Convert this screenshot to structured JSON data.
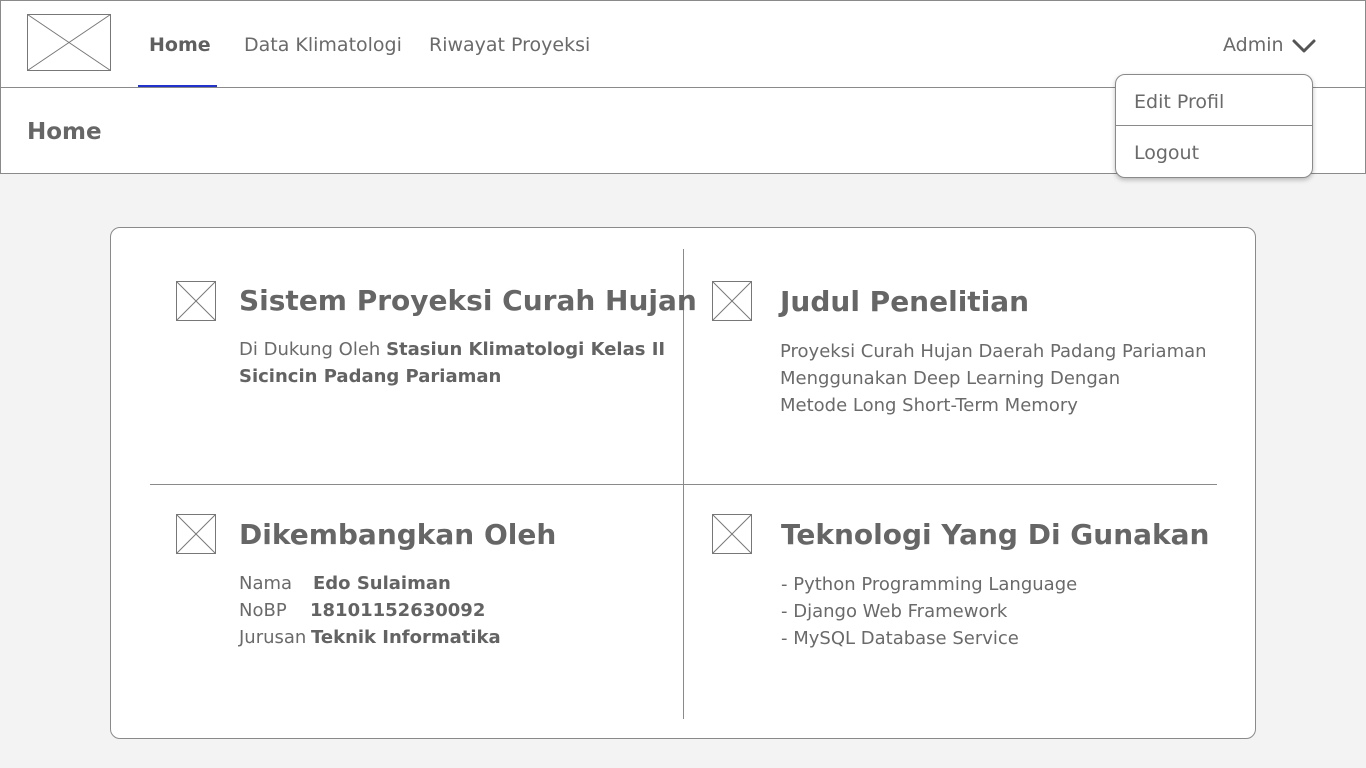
{
  "nav": {
    "items": [
      {
        "label": "Home",
        "active": true
      },
      {
        "label": "Data Klimatologi",
        "active": false
      },
      {
        "label": "Riwayat Proyeksi",
        "active": false
      }
    ],
    "user_label": "Admin",
    "accent_color": "#2233cc"
  },
  "header": {
    "title": "Home"
  },
  "dropdown": {
    "items": [
      "Edit Profil",
      "Logout"
    ]
  },
  "sections": {
    "system": {
      "title": "Sistem Proyeksi Curah Hujan",
      "prefix": "Di Dukung Oleh ",
      "bold_1": "Stasiun Klimatologi Kelas II",
      "bold_2": "Sicincin Padang Pariaman"
    },
    "research": {
      "title": "Judul Penelitian",
      "lines": [
        "Proyeksi Curah Hujan Daerah Padang Pariaman",
        "Menggunakan Deep Learning Dengan",
        "Metode Long Short-Term Memory"
      ]
    },
    "developer": {
      "title": "Dikembangkan Oleh",
      "fields": [
        {
          "label": "Nama",
          "value": "Edo Sulaiman"
        },
        {
          "label": "NoBP",
          "value": "18101152630092"
        },
        {
          "label": "Jurusan",
          "value": "Teknik Informatika"
        }
      ]
    },
    "technology": {
      "title": "Teknologi Yang Di Gunakan",
      "items": [
        "- Python Programming Language",
        "- Django Web Framework",
        "- MySQL Database Service"
      ]
    }
  },
  "icons": {
    "logo": "image-placeholder-icon",
    "section": "image-placeholder-icon",
    "user_menu": "chevron-down-icon"
  }
}
